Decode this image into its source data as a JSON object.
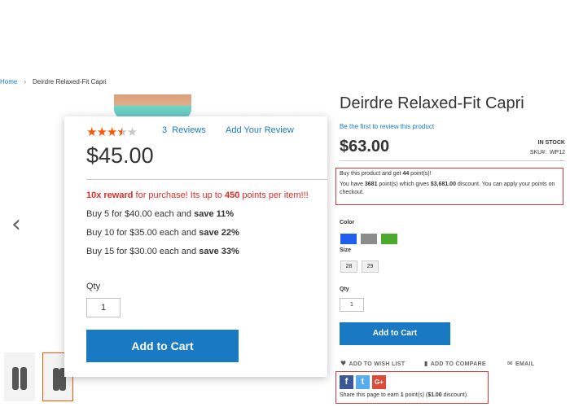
{
  "breadcrumb": {
    "home": "Home",
    "separator": "›",
    "current": "Deirdre Relaxed-Fit Capri"
  },
  "gallery": {
    "prev_icon": "‹"
  },
  "popup": {
    "rating_stars": 3.5,
    "stars": {
      "on": "★★★",
      "half": "★",
      "off": "★"
    },
    "reviews": "3  Reviews",
    "add_review": "Add Your Review",
    "price": "$45.00",
    "reward": {
      "multiplier": "10x reward",
      "text1": " for purchase! Its up to ",
      "points": "450",
      "text2": " points per item!!!"
    },
    "tiers": [
      {
        "text": "Buy 5 for $40.00 each and ",
        "save": "save 11%"
      },
      {
        "text": "Buy 10 for $35.00 each and ",
        "save": "save 22%"
      },
      {
        "text": "Buy 15 for $30.00 each and ",
        "save": "save 33%"
      }
    ],
    "qty_label": "Qty",
    "qty_value": "1",
    "add_to_cart": "Add to Cart"
  },
  "product": {
    "title": "Deirdre Relaxed-Fit Capri",
    "first_review": "Be the first to review this product",
    "price": "$63.00",
    "stock": "IN STOCK",
    "sku_label": "SKU#:",
    "sku": "WP12",
    "points": {
      "l1_pre": "Buy this product and get ",
      "l1_num": "44",
      "l1_post": " point(s)!",
      "l2_pre": "You have ",
      "l2_num": "3681",
      "l2_mid": " point(s) which gives ",
      "l2_amt": "$3,681.00",
      "l2_post": " discount. You can apply your points on checkout."
    },
    "color_label": "Color",
    "colors": [
      "#1f5ff0",
      "#8c8c8c",
      "#4aaa2e"
    ],
    "size_label": "Size",
    "sizes": [
      "28",
      "29"
    ],
    "qty_label": "Qty",
    "qty_value": "1",
    "add_to_cart": "Add to Cart",
    "actions": {
      "wishlist": "ADD TO WISH LIST",
      "compare": "ADD TO COMPARE",
      "email": "EMAIL"
    },
    "share": {
      "facebook": "f",
      "twitter": "t",
      "google": "G+",
      "pre": "Share this page to earn ",
      "num": "1",
      "mid": " point(s) (",
      "amt": "$1.00",
      "post": " discount)."
    }
  }
}
